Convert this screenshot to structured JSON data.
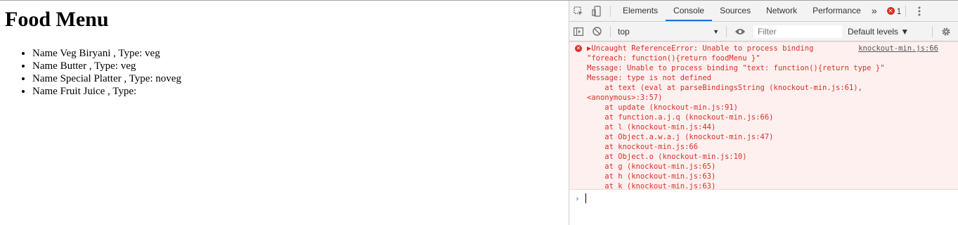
{
  "page": {
    "title": "Food Menu",
    "items": [
      "Name Veg Biryani , Type: veg",
      "Name Butter , Type: veg",
      "Name Special Platter , Type: noveg",
      "Name Fruit Juice , Type:"
    ]
  },
  "devtools": {
    "tabs": [
      "Elements",
      "Console",
      "Sources",
      "Network",
      "Performance"
    ],
    "active_tab": "Console",
    "more_tabs": "»",
    "error_count": "1",
    "context": "top",
    "filter_placeholder": "Filter",
    "levels": "Default levels ▼",
    "error": {
      "source": "knockout-min.js:66",
      "lines": [
        "▶Uncaught ReferenceError: Unable to process binding",
        "\"foreach: function(){return foodMenu }\"",
        "Message: Unable to process binding \"text: function(){return type }\"",
        "Message: type is not defined",
        "    at text (eval at parseBindingsString (knockout-min.js:61),",
        "<anonymous>:3:57)",
        "    at update (knockout-min.js:91)",
        "    at function.a.j.q (knockout-min.js:66)",
        "    at l (knockout-min.js:44)",
        "    at Object.a.w.a.j (knockout-min.js:47)",
        "    at knockout-min.js:66",
        "    at Object.o (knockout-min.js:10)",
        "    at g (knockout-min.js:65)",
        "    at h (knockout-min.js:63)",
        "    at k (knockout-min.js:63)"
      ]
    },
    "prompt_symbol": "›",
    "colors": {
      "error": "#d93025",
      "accent": "#1a73e8",
      "error_bg": "#fff0f0"
    },
    "icons": [
      "inspect-icon",
      "device-toggle-icon",
      "kebab-menu-icon",
      "sidebar-toggle-icon",
      "clear-console-icon",
      "eye-icon",
      "settings-gear-icon"
    ]
  }
}
